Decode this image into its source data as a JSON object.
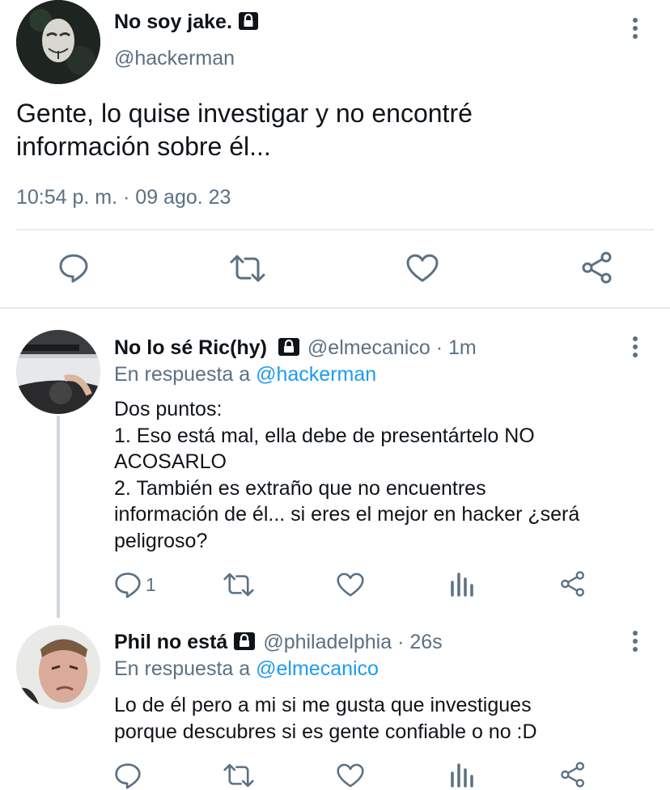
{
  "main_tweet": {
    "display_name": "No soy jake.",
    "handle": "@hackerman",
    "text_line1": "Gente, lo quise investigar y no encontré",
    "text_line2": "información sobre él...",
    "timestamp": "10:54 p. m. · 09 ago. 23"
  },
  "replies": [
    {
      "display_name": "No lo sé Ric(hy)",
      "handle": "@elmecanico · 1m",
      "reply_prefix": "En respuesta a",
      "reply_to": "@hackerman",
      "lines": [
        "Dos puntos:",
        "1. Eso está mal, ella debe de presentártelo NO",
        "ACOSARLO",
        "2. También es extraño que no encuentres",
        "información de él... si eres el mejor en hacker ¿será",
        "peligroso?"
      ],
      "reply_count": "1"
    },
    {
      "display_name": "Phil no está",
      "handle": "@philadelphia · 26s",
      "reply_prefix": "En respuesta a",
      "reply_to": "@elmecanico",
      "lines": [
        "Lo de él pero a mi si me gusta que investigues",
        "porque descubres si es gente confiable o no :D"
      ]
    }
  ],
  "colors": {
    "text": "#0f1419",
    "secondary": "#5b7083",
    "link": "#1d9bf0",
    "divider": "#e6ecf0"
  }
}
